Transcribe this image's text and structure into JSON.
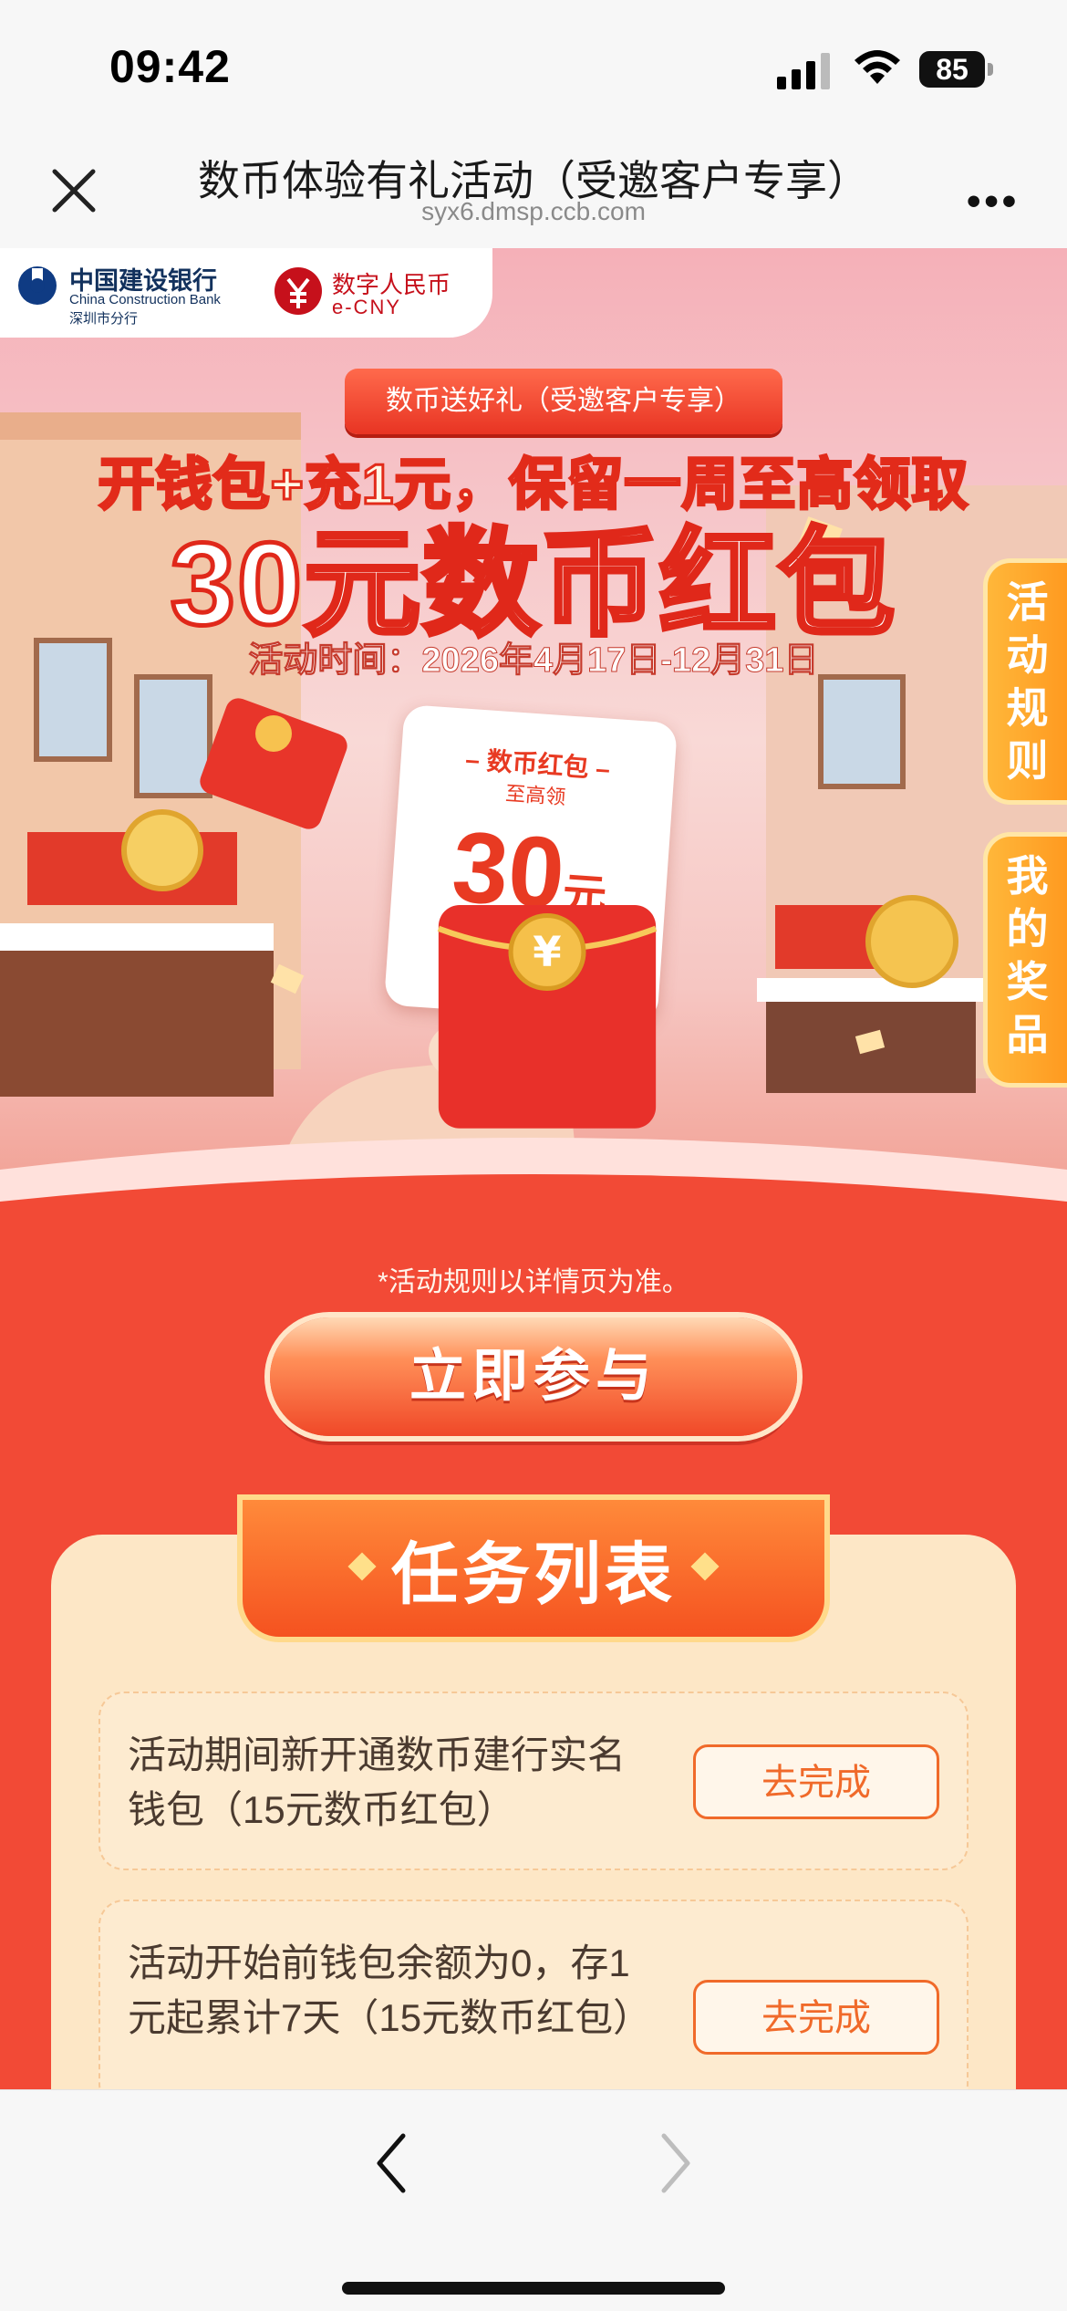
{
  "status": {
    "time": "09:42",
    "battery": "85"
  },
  "nav": {
    "title": "数币体验有礼活动（受邀客户专享）",
    "url": "syx6.dmsp.ccb.com"
  },
  "logos": {
    "ccb_cn": "中国建设银行",
    "ccb_en": "China Construction Bank",
    "ccb_branch": "深圳市分行",
    "ecny_cn": "数字人民币",
    "ecny_en": "e-CNY"
  },
  "hero": {
    "ribbon": "数币送好礼（受邀客户专享）",
    "headline_line1": "开钱包+充1元，保留一周至高领取",
    "headline_line2": "30元数币红包",
    "period": "活动时间：2026年4月17日-12月31日",
    "card_title": "– 数币红包 –",
    "card_sub": "至高领",
    "card_amount": "30",
    "card_unit": "元"
  },
  "side_tabs": {
    "rules": "活动规则",
    "prizes": "我的奖品"
  },
  "note": "*活动规则以详情页为准。",
  "cta_label": "立即参与",
  "tasks": {
    "title": "任务列表",
    "items": [
      {
        "text": "活动期间新开通数币建行实名钱包（15元数币红包）",
        "button": "去完成"
      },
      {
        "text": "活动开始前钱包余额为0，存1元起累计7天（15元数币红包）",
        "button": "去完成"
      }
    ]
  },
  "colors": {
    "brand_red": "#f24a36",
    "accent_orange": "#f06a2a",
    "panel": "#fde7c6"
  }
}
